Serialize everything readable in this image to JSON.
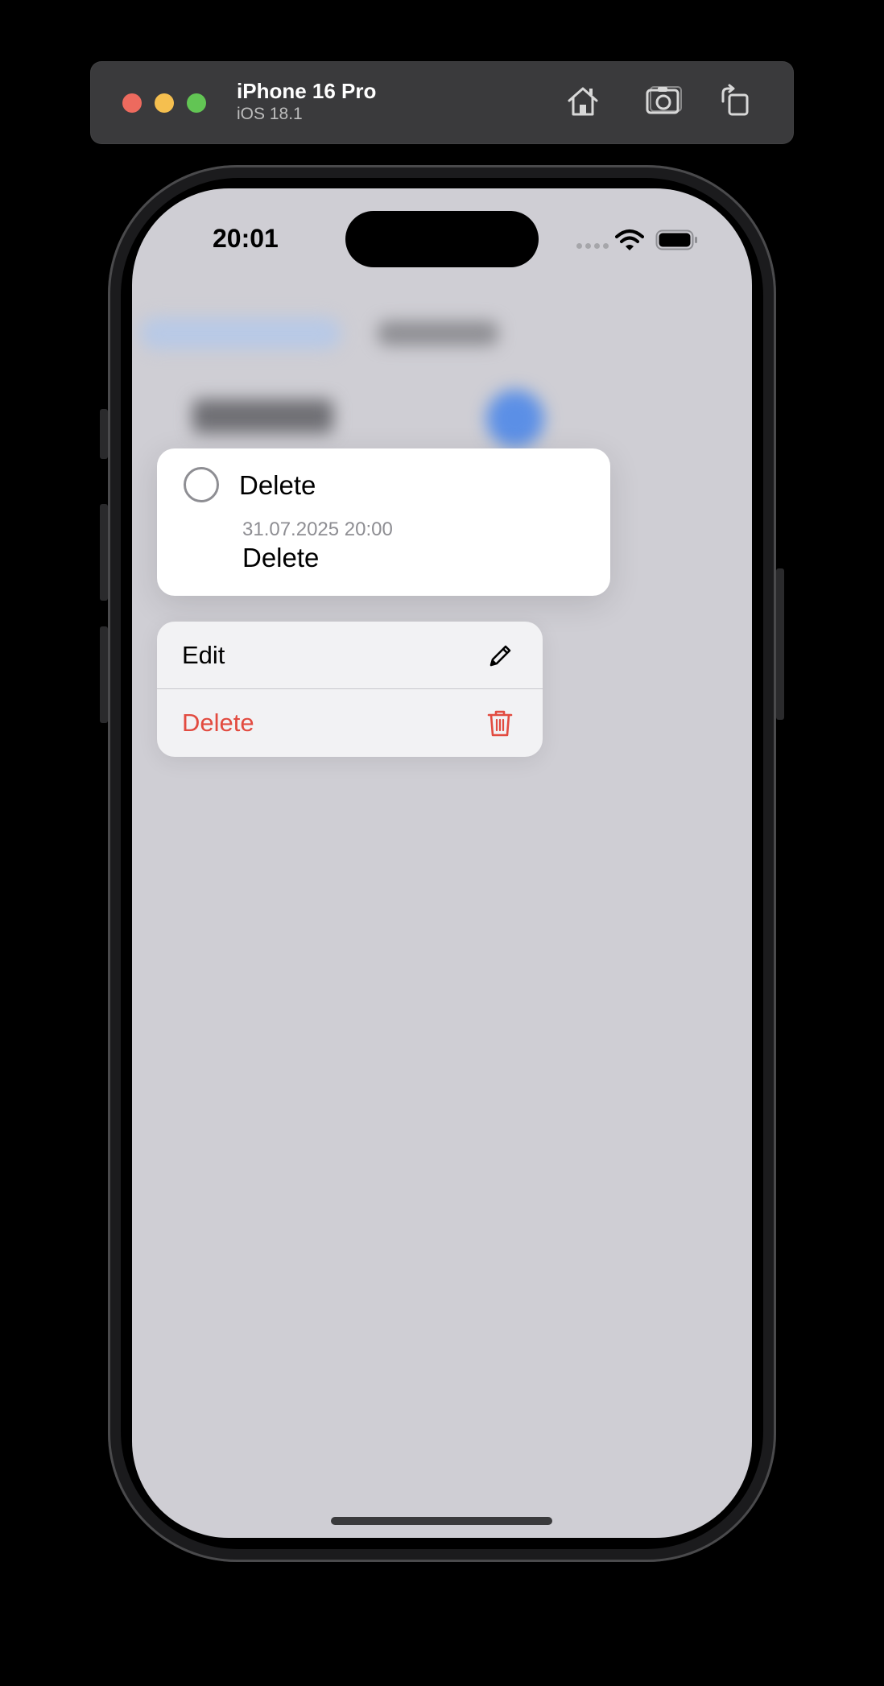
{
  "simulator": {
    "device_name": "iPhone 16 Pro",
    "os_version": "iOS 18.1",
    "toolbar_icons": [
      "home-icon",
      "screenshot-icon",
      "rotate-icon"
    ]
  },
  "status_bar": {
    "time": "20:01",
    "icons": [
      "signal-icon",
      "wifi-icon",
      "battery-icon"
    ]
  },
  "preview_card": {
    "title": "Delete",
    "date": "31.07.2025 20:00",
    "note": "Delete"
  },
  "context_menu": {
    "items": [
      {
        "label": "Edit",
        "icon": "pencil-icon",
        "color": "#000000"
      },
      {
        "label": "Delete",
        "icon": "trash-icon",
        "color": "#e24b40"
      }
    ]
  },
  "colors": {
    "screen_dim": "#cfced4",
    "destructive": "#e24b40",
    "accent_blurred": "#5b8fe6"
  }
}
